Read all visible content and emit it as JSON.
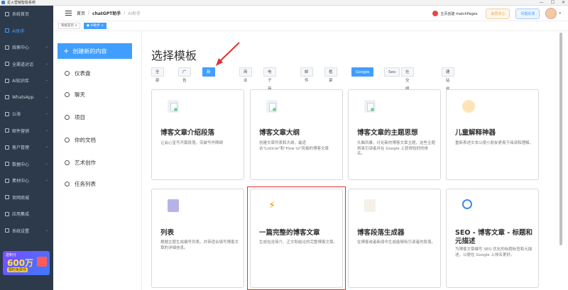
{
  "window": {
    "title": "星火营销智能系统",
    "controls": [
      "—",
      "☐",
      "✕"
    ]
  },
  "sidebar": {
    "items": [
      {
        "label": "系统首页",
        "icon": "home-icon",
        "chevron": false,
        "active": false
      },
      {
        "label": "AI助手",
        "icon": "robot-icon",
        "chevron": false,
        "active": true
      },
      {
        "label": "线索中心",
        "icon": "target-icon",
        "chevron": true,
        "active": false
      },
      {
        "label": "全渠道对话",
        "icon": "chat-icon",
        "chevron": true,
        "active": false
      },
      {
        "label": "AI知识库",
        "icon": "database-icon",
        "chevron": true,
        "active": false
      },
      {
        "label": "WhatsApp",
        "icon": "whatsapp-icon",
        "chevron": true,
        "active": false
      },
      {
        "label": "公海",
        "icon": "ocean-icon",
        "chevron": true,
        "active": false
      },
      {
        "label": "邮件营销",
        "icon": "mail-icon",
        "chevron": true,
        "active": false
      },
      {
        "label": "客户管理",
        "icon": "users-icon",
        "chevron": true,
        "active": false
      },
      {
        "label": "数据中心",
        "icon": "chart-icon",
        "chevron": true,
        "active": false
      },
      {
        "label": "素材中心",
        "icon": "folder-icon",
        "chevron": true,
        "active": false
      },
      {
        "label": "官网商城",
        "icon": "shop-icon",
        "chevron": false,
        "active": false
      },
      {
        "label": "应用集成",
        "icon": "apps-icon",
        "chevron": false,
        "active": false
      },
      {
        "label": "系统设置",
        "icon": "settings-icon",
        "chevron": true,
        "active": false
      }
    ],
    "promo": {
      "top": "送积分",
      "amount": "600万",
      "cta": "限时免费领"
    }
  },
  "topbar": {
    "breadcrumb": [
      "首页",
      "chatGPT助手",
      "AI助手"
    ],
    "notify_label": "主页创建 matchPages",
    "pill1": "会员中心",
    "pill2": "问题反馈"
  },
  "tags": [
    {
      "label": "系统首页 ×"
    },
    {
      "label": "● AI助手 ×"
    }
  ],
  "leftpanel": {
    "create_label": "创建新的内容",
    "items": [
      {
        "label": "仪表盘",
        "icon": "dashboard-icon"
      },
      {
        "label": "聊天",
        "icon": "chat-icon"
      },
      {
        "label": "项目",
        "icon": "lightbulb-icon"
      },
      {
        "label": "你的文档",
        "icon": "document-icon"
      },
      {
        "label": "艺术创作",
        "icon": "bulb-icon"
      },
      {
        "label": "任务列表",
        "icon": "tasks-icon"
      }
    ]
  },
  "main": {
    "heading": "选择模板",
    "filters": [
      "全部",
      "广告",
      "新闻博客",
      "商业",
      "电子商务",
      "邮件",
      "框架",
      "Google",
      "Seo",
      "社交媒体",
      "建站创作"
    ],
    "selected_filters": [
      "新闻博客",
      "Google"
    ],
    "cards": [
      {
        "title": "博客文章介绍段落",
        "desc": "让会心呈写开篇段落，突破写作障碍",
        "icon": "document-icon"
      },
      {
        "title": "博客文章大纲",
        "desc": "创建文章列表和大纲，最适合\"Listicle\"和\"How to\"风格的博客文章",
        "icon": "document-icon"
      },
      {
        "title": "博客文章的主题思想",
        "desc": "头脑风暴，讨论新的博客文章主题，这些主题将吸引读者并在 Google 上获得较好的排名。",
        "icon": "document-icon"
      },
      {
        "title": "儿童解释神器",
        "desc": "重新表述文本以使小朋友更易于阅读和理解。",
        "icon": "kid-icon"
      },
      {
        "title": "列表",
        "desc": "根据主题生成编号列表。并带适合填写博客文章的详细信息。",
        "icon": "book-icon"
      },
      {
        "title": "一篇完整的博客文章",
        "desc": "生成包含简介、正文和结论的完整博客文章。",
        "icon": "bolt-icon"
      },
      {
        "title": "博客段落生成器",
        "desc": "在博客或者新闻中生成能够吸引读者的段落。",
        "icon": "pen-icon"
      },
      {
        "title": "SEO - 博客文章 - 标题和元描述",
        "desc": "为博客文章编写 SEO 优化的标题标签和元描述，以便在 Google 上排名更好。",
        "icon": "magnifier-icon"
      }
    ]
  },
  "colors": {
    "accent": "#409eff",
    "sidebar_bg": "#2d3a4b",
    "highlight": "#e03131",
    "arrow": "#e03131"
  }
}
